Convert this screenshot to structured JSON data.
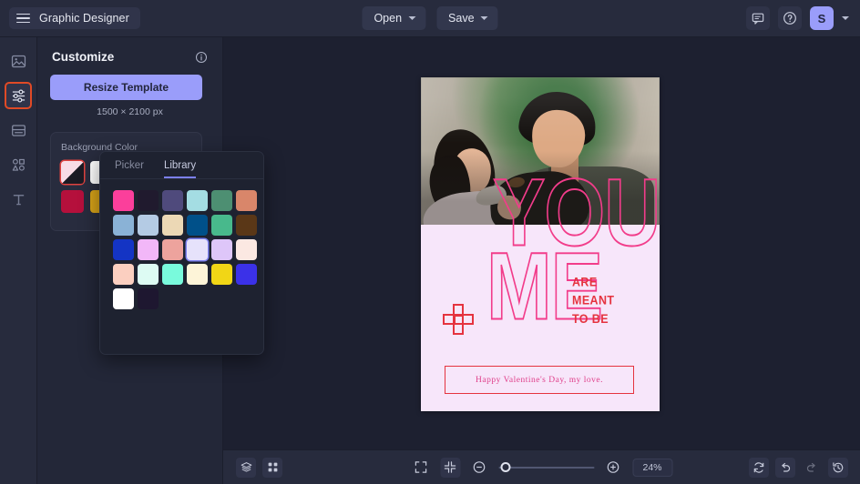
{
  "app": {
    "brand": "Graphic Designer",
    "menu_icon": "hamburger-icon"
  },
  "topbar": {
    "open_label": "Open",
    "save_label": "Save",
    "comment_icon": "comment-icon",
    "help_icon": "help-circle-icon",
    "avatar_initial": "S",
    "accent_color": "#9a9dfa"
  },
  "rail": {
    "items": [
      {
        "name": "image-tool",
        "icon": "image-icon",
        "active": false
      },
      {
        "name": "customize-tool",
        "icon": "sliders-icon",
        "active": true
      },
      {
        "name": "layout-tool",
        "icon": "layout-icon",
        "active": false
      },
      {
        "name": "shapes-tool",
        "icon": "shapes-icon",
        "active": false
      },
      {
        "name": "text-tool",
        "icon": "text-icon",
        "active": false
      }
    ],
    "active_outline_color": "#e04a26"
  },
  "panel": {
    "title": "Customize",
    "info_icon": "info-icon",
    "resize_label": "Resize Template",
    "dimensions": "1500 × 2100 px",
    "background_color_label": "Background Color",
    "swatches": [
      {
        "name": "swatch-blush",
        "color": "#f8dce6",
        "selected": true
      },
      {
        "name": "swatch-white",
        "color": "#ffffff",
        "selected": false
      },
      {
        "name": "swatch-crimson",
        "color": "#b5103c",
        "selected": false
      },
      {
        "name": "swatch-gold",
        "color": "#d7a318",
        "selected": false
      }
    ]
  },
  "color_popover": {
    "tabs": [
      {
        "label": "Picker",
        "active": false
      },
      {
        "label": "Library",
        "active": true
      }
    ],
    "active_underline_color": "#7c80f0",
    "library_swatches": [
      {
        "name": "swatch-hot-pink",
        "color": "#fb3f9b",
        "selected": false
      },
      {
        "name": "swatch-near-black-purple",
        "color": "#201a2e",
        "selected": false
      },
      {
        "name": "swatch-slate-purple",
        "color": "#4f4a7c",
        "selected": false
      },
      {
        "name": "swatch-pale-aqua",
        "color": "#a4dde3",
        "selected": false
      },
      {
        "name": "swatch-sea-green",
        "color": "#4d8f72",
        "selected": false
      },
      {
        "name": "swatch-salmon",
        "color": "#d9866a",
        "selected": false
      },
      {
        "name": "swatch-steel-blue",
        "color": "#8ab2d6",
        "selected": false
      },
      {
        "name": "swatch-light-blue",
        "color": "#b4cbe4",
        "selected": false
      },
      {
        "name": "swatch-sand",
        "color": "#ecd8b5",
        "selected": false
      },
      {
        "name": "swatch-deep-blue",
        "color": "#005089",
        "selected": false
      },
      {
        "name": "swatch-emerald",
        "color": "#48b98c",
        "selected": false
      },
      {
        "name": "swatch-brown",
        "color": "#5a3717",
        "selected": false
      },
      {
        "name": "swatch-royal-blue",
        "color": "#1434c4",
        "selected": false
      },
      {
        "name": "swatch-orchid",
        "color": "#f2b7f8",
        "selected": false
      },
      {
        "name": "swatch-rose",
        "color": "#eda39d",
        "selected": false
      },
      {
        "name": "swatch-lavender-white",
        "color": "#e6e2fb",
        "selected": true
      },
      {
        "name": "swatch-light-lavender",
        "color": "#dec6f9",
        "selected": false
      },
      {
        "name": "swatch-cream-pink",
        "color": "#fbe8e2",
        "selected": false
      },
      {
        "name": "swatch-peach",
        "color": "#fbcfc0",
        "selected": false
      },
      {
        "name": "swatch-mint-ice",
        "color": "#ddfbf3",
        "selected": false
      },
      {
        "name": "swatch-aquamarine",
        "color": "#79fadc",
        "selected": false
      },
      {
        "name": "swatch-ivory",
        "color": "#fdf4d8",
        "selected": false
      },
      {
        "name": "swatch-yellow",
        "color": "#f1d616",
        "selected": false
      },
      {
        "name": "swatch-indigo",
        "color": "#3b31e8",
        "selected": false
      },
      {
        "name": "swatch-white",
        "color": "#ffffff",
        "selected": false
      },
      {
        "name": "swatch-ink",
        "color": "#1e1730",
        "selected": false
      }
    ]
  },
  "canvas": {
    "background": "#f7e6fa",
    "photo_alt": "couple holding a black dog outdoors",
    "headline_line1": "YOU",
    "plus_symbol": "plus-cross-icon",
    "headline_line2": "ME",
    "tagline": "ARE\nMEANT\nTO BE",
    "tagline_lines": [
      "ARE",
      "MEANT",
      "TO BE"
    ],
    "message": "Happy Valentine's Day, my love.",
    "outline_color": "#f23c8a",
    "accent_red": "#e5333f",
    "message_color": "#e0418b"
  },
  "bottombar": {
    "layers_icon": "layers-icon",
    "grid_icon": "grid-icon",
    "fit_icon": "fit-screen-icon",
    "shrink_icon": "shrink-icon",
    "zoom_out_icon": "zoom-out-icon",
    "zoom_in_icon": "zoom-in-icon",
    "zoom_value": "24%",
    "refresh_icon": "refresh-icon",
    "undo_icon": "undo-icon",
    "redo_icon": "redo-icon",
    "history_icon": "history-icon"
  }
}
